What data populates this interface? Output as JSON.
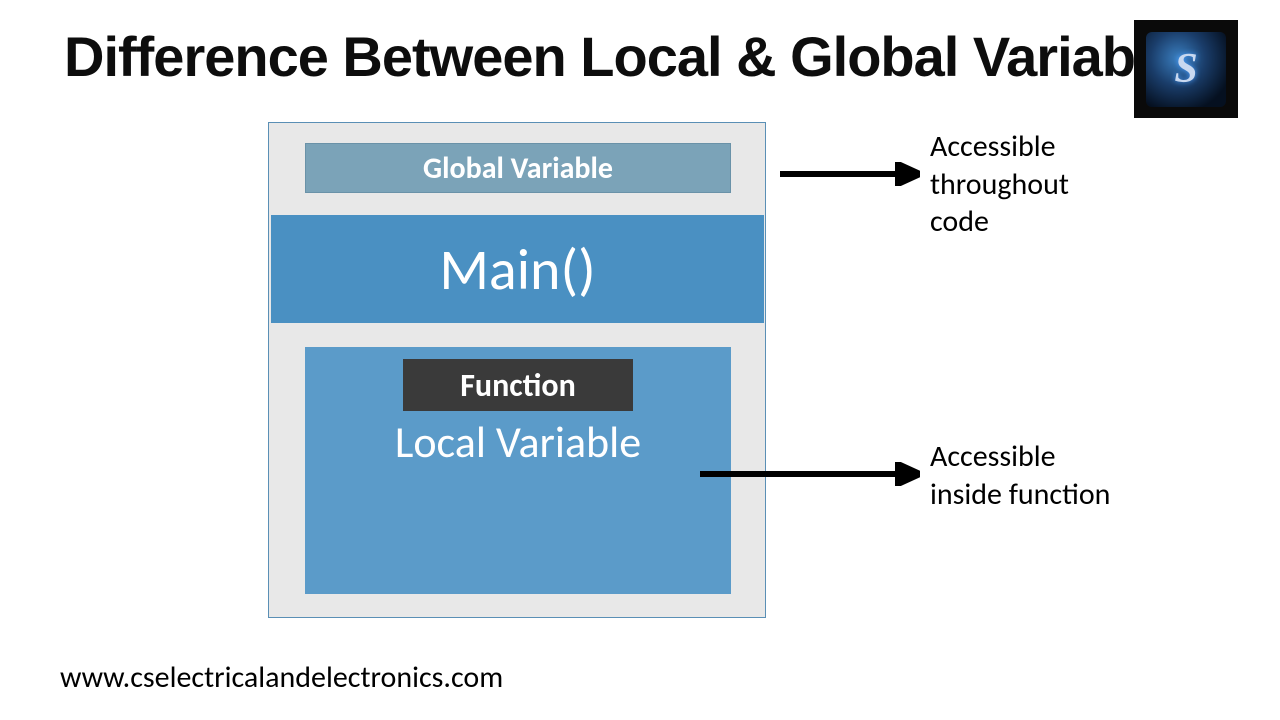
{
  "title": "Difference Between Local & Global Variable",
  "diagram": {
    "global_variable_label": "Global Variable",
    "main_label": "Main()",
    "function_label": "Function",
    "local_variable_label": "Local Variable"
  },
  "annotations": {
    "global_note_line1": "Accessible",
    "global_note_line2": "throughout",
    "global_note_line3": "code",
    "local_note_line1": "Accessible",
    "local_note_line2": "inside function"
  },
  "url": "www.cselectricalandelectronics.com",
  "logo": {
    "letter": "S"
  }
}
